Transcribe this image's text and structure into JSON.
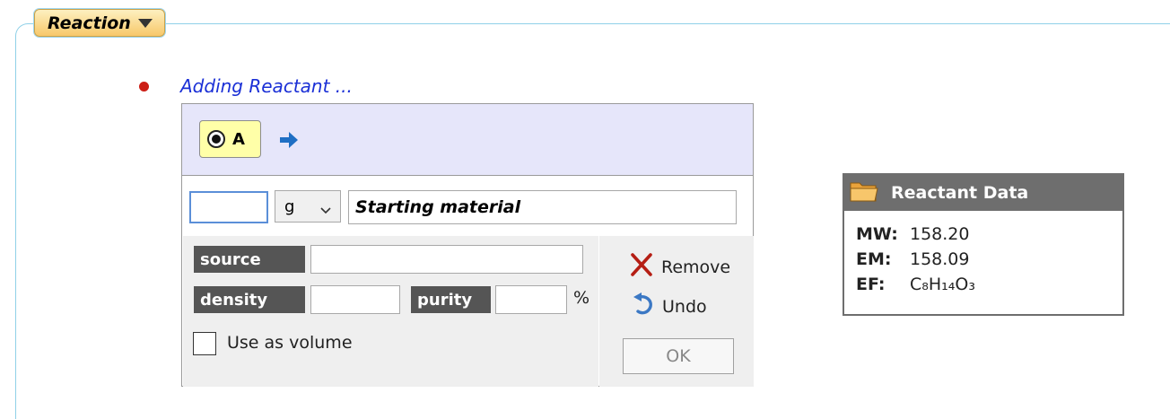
{
  "section": {
    "tab_label": "Reaction"
  },
  "adding": {
    "title": "Adding Reactant ..."
  },
  "reactant": {
    "label": "A",
    "amount_value": "",
    "unit": "g",
    "name": "Starting material",
    "source_label": "source",
    "source_value": "",
    "density_label": "density",
    "density_value": "",
    "purity_label": "purity",
    "purity_value": "",
    "purity_unit": "%",
    "use_as_volume_label": "Use as volume",
    "use_as_volume_checked": false
  },
  "actions": {
    "remove_label": "Remove",
    "undo_label": "Undo",
    "ok_label": "OK"
  },
  "data_panel": {
    "title": "Reactant Data",
    "rows": [
      {
        "key": "MW:",
        "value": "158.20"
      },
      {
        "key": "EM:",
        "value": "158.09"
      },
      {
        "key": "EF:",
        "value": "C₈H₁₄O₃"
      }
    ]
  },
  "colors": {
    "accent_blue": "#1a2fd6",
    "bullet_red": "#cc1e16",
    "header_lavender": "#e6e6fa",
    "label_yellow": "#ffffa8",
    "tab_orange": "#f7c86a",
    "dark_label": "#555555"
  },
  "icons": {
    "section_caret": "caret-down-icon",
    "next": "arrow-right-icon",
    "remove": "x-icon",
    "undo": "undo-icon",
    "data_panel": "folder-icon"
  }
}
